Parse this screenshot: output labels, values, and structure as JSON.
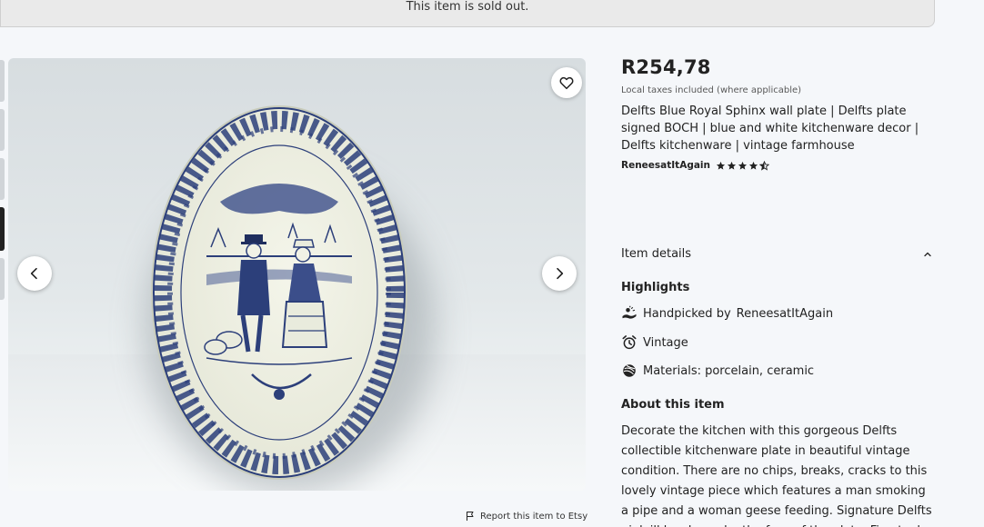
{
  "banner": {
    "text": "This item is sold out."
  },
  "gallery": {
    "favorite_label": "Add to favourites",
    "prev_label": "Previous image",
    "next_label": "Next image"
  },
  "report": {
    "label": "Report this item to Etsy"
  },
  "listing": {
    "price": "R254,78",
    "tax_note": "Local taxes included (where applicable)",
    "title": "Delfts Blue Royal Sphinx wall plate | Delfts plate signed BOCH | blue and white kitchenware decor | Delfts kitchenware | vintage farmhouse",
    "shop_name": "ReneesatItAgain",
    "rating": 4.5
  },
  "details": {
    "heading": "Item details",
    "highlights_title": "Highlights",
    "handpicked_prefix": "Handpicked by",
    "handpicked_shop": "ReneesatItAgain",
    "vintage": "Vintage",
    "materials": "Materials: porcelain, ceramic",
    "about_title": "About this item",
    "about_text": "Decorate the kitchen with this gorgeous Delfts collectible kitchenware plate in beautiful vintage condition. There are no chips, breaks, cracks to this lovely vintage piece which features a man smoking a pipe and a woman geese feeding. Signature Delfts pink ill be shown by the face of the plate. Fine teal"
  },
  "colors": {
    "delft_blue": "#2c3f7a",
    "plate_cream": "#f1f2e6",
    "text": "#222222"
  },
  "icons": [
    "heart-icon",
    "chevron-left-icon",
    "chevron-right-icon",
    "flag-icon",
    "chevron-up-icon",
    "hands-icon",
    "alarm-clock-icon",
    "yarn-icon",
    "star-icon"
  ]
}
